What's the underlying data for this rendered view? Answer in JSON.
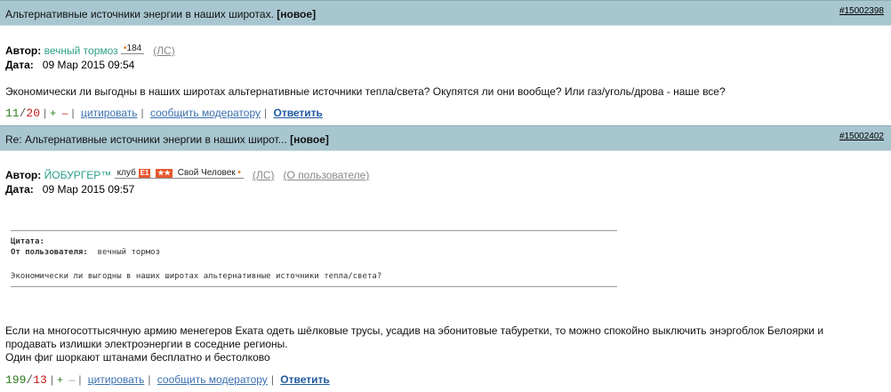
{
  "post1": {
    "title": "Альтернативные источники энергии в наших широтах.",
    "new_tag": "[новое]",
    "id": "#15002398",
    "author_label": "Автор:",
    "author": "вечный тормоз",
    "badge": "184",
    "pm": "(ЛС)",
    "date_label": "Дата:",
    "date": "09 Мар 2015 09:54",
    "body": "Экономически ли выгодны в наших широтах альтернативные источники тепла/света? Окупятся ли они вообще? Или газ/уголь/дрова - наше все?",
    "rating_pos": "11",
    "rating_neg": "20",
    "plus": "+",
    "minus": "–",
    "cite": "цитировать",
    "report": "сообщить модератору",
    "reply": "Ответить"
  },
  "post2": {
    "title": "Re: Альтернативные источники энергии в наших широт...",
    "new_tag": "[новое]",
    "id": "#15002402",
    "author_label": "Автор:",
    "author": "ЙОБУРГЕР™",
    "club_label": "клуб",
    "club_tag": "E1",
    "badge_tag": "★★",
    "status": "Свой Человек",
    "pm": "(ЛС)",
    "about": "(О пользователе)",
    "date_label": "Дата:",
    "date": "09 Мар 2015 09:57",
    "quote_label": "Цитата:",
    "quote_from_label": "От пользователя:",
    "quote_from": "вечный тормоз",
    "quote_text": "Экономически ли выгодны в наших широтах альтернативные источники тепла/света?",
    "body_line1": "Если на многосоттысячную армию менегеров Еката одеть шёлковые трусы, усадив на эбонитовые табуретки, то можно спокойно выключить энэргоблок Белоярки и",
    "body_line2": "продавать излишки электроэнергии в соседние регионы.",
    "body_line3": "Один фиг шоркают штанами бесплатно и бестолково",
    "rating_pos": "199",
    "rating_neg": "13",
    "plus": "+",
    "minus": "–",
    "cite": "цитировать",
    "report": "сообщить модератору",
    "reply": "Ответить"
  }
}
